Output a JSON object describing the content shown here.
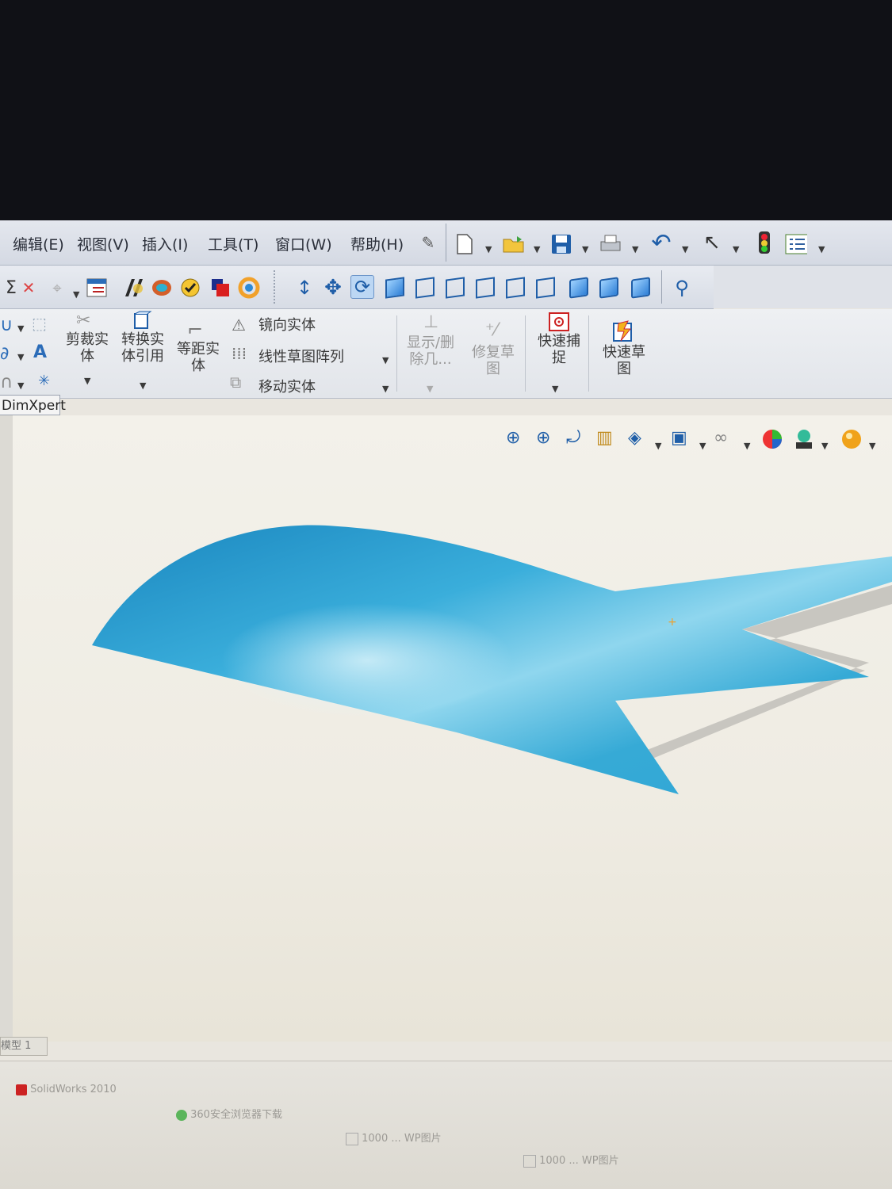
{
  "menu": {
    "items": [
      "编辑(E)",
      "视图(V)",
      "插入(I)",
      "工具(T)",
      "窗口(W)",
      "帮助(H)"
    ]
  },
  "command_manager": {
    "trim_entities": "剪裁实\n体",
    "convert_entities": "转换实\n体引用",
    "offset_entities": "等距实\n体",
    "mirror_entities": "镜向实体",
    "linear_pattern": "线性草图阵列",
    "move_entities": "移动实体",
    "display_delete": "显示/删\n除几...",
    "repair_sketch": "修复草\n图",
    "quick_snaps": "快速捕\n捉",
    "rapid_sketch": "快速草\n图"
  },
  "tabs": {
    "dimxpert": "DimXpert"
  },
  "status": {
    "model_tab": "模型 1"
  },
  "taskbar": {
    "app1": "SolidWorks 2010",
    "app2": "360安全浏览器下载",
    "app3": "1000 ... WP图片",
    "app4": "1000 ... WP图片"
  },
  "colors": {
    "surface_main": "#2fa6d6",
    "surface_light": "#8fd6ee",
    "surface_edge": "#c8c6c0",
    "accent_blue": "#1c4e92"
  },
  "icons": [
    "sketch-icon",
    "new-file-icon",
    "open-file-icon",
    "save-icon",
    "print-icon",
    "undo-icon",
    "select-icon",
    "rebuild-icon",
    "options-icon",
    "zoom-to-fit-icon",
    "zoom-area-icon",
    "previous-view-icon",
    "section-view-icon",
    "view-orientation-icon",
    "display-style-icon",
    "hide-show-icon",
    "edit-appearance-icon",
    "apply-scene-icon",
    "view-settings-icon"
  ]
}
